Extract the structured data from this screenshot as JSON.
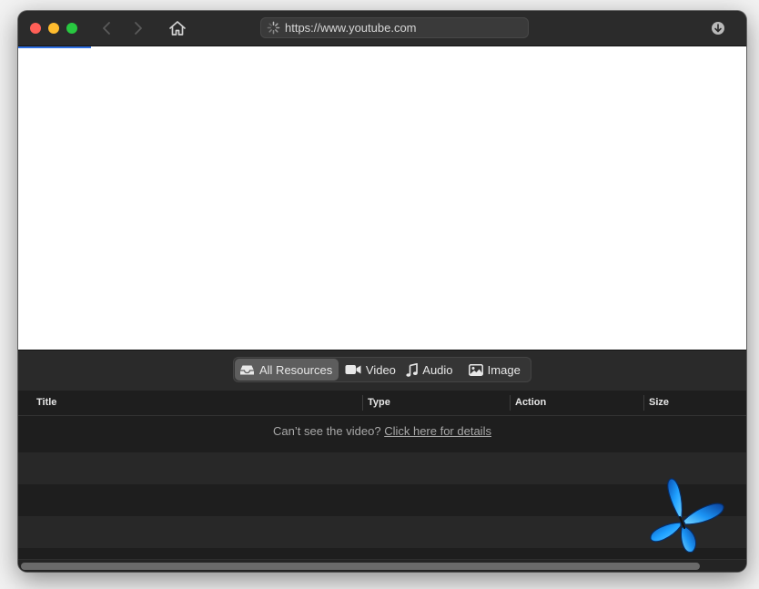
{
  "browser": {
    "url": "https://www.youtube.com",
    "loading": true
  },
  "filters": {
    "active": "All Resources",
    "items": [
      {
        "label": "All Resources",
        "icon": "inbox-tray-icon"
      },
      {
        "label": "Video",
        "icon": "video-camera-icon"
      },
      {
        "label": "Audio",
        "icon": "music-note-icon"
      },
      {
        "label": "Image",
        "icon": "photo-icon"
      }
    ]
  },
  "table": {
    "columns": [
      "Title",
      "Type",
      "Action",
      "Size"
    ],
    "notice_text": "Can’t see the video?",
    "notice_link": "Click here for details"
  },
  "colors": {
    "accent_loadbar": "#2f6fe0",
    "close": "#ff5f57",
    "minimize": "#febc2e",
    "maximize": "#28c840",
    "butterfly": "#1e9bff"
  }
}
